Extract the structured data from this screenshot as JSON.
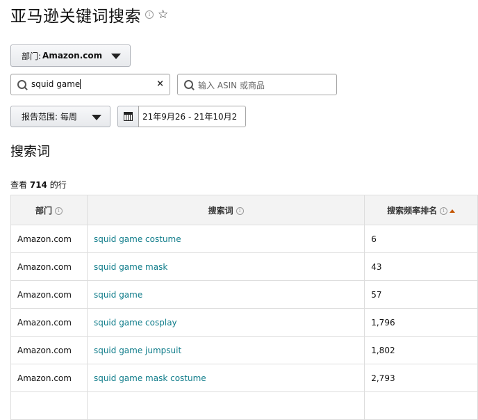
{
  "page": {
    "title": "亚马逊关键词搜索"
  },
  "filters": {
    "department_label": "部门:",
    "department_value": "Amazon.com",
    "search_value": "squid game",
    "clear_symbol": "×",
    "asin_placeholder": "输入 ASIN 或商品",
    "report_range_label": "报告范围: 每周",
    "date_range": "21年9月26 - 21年10月2"
  },
  "section": {
    "title": "搜索词",
    "count_prefix": "查看",
    "count": "714",
    "count_suffix": "的行"
  },
  "table": {
    "columns": [
      "部门",
      "搜索词",
      "搜索频率排名"
    ],
    "rows": [
      {
        "department": "Amazon.com",
        "term": "squid game costume",
        "rank": "6"
      },
      {
        "department": "Amazon.com",
        "term": "squid game mask",
        "rank": "43"
      },
      {
        "department": "Amazon.com",
        "term": "squid game",
        "rank": "57"
      },
      {
        "department": "Amazon.com",
        "term": "squid game cosplay",
        "rank": "1,796"
      },
      {
        "department": "Amazon.com",
        "term": "squid game jumpsuit",
        "rank": "1,802"
      },
      {
        "department": "Amazon.com",
        "term": "squid game mask costume",
        "rank": "2,793"
      }
    ],
    "colors": {
      "link": "#0f7c8a",
      "sorted": "#c45500"
    }
  },
  "icons": {
    "info": "info-icon",
    "star": "star-icon",
    "search": "search-icon",
    "calendar": "calendar-icon"
  }
}
